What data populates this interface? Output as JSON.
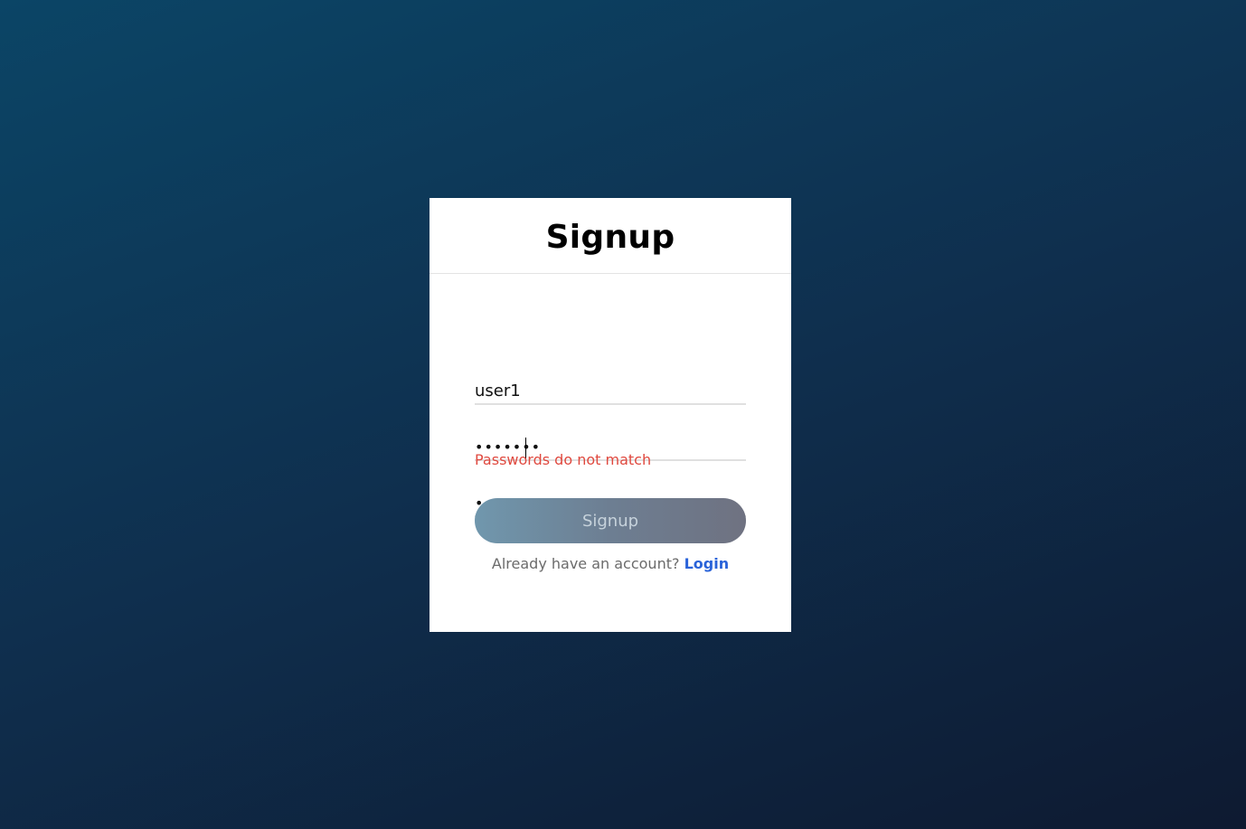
{
  "card": {
    "title": "Signup"
  },
  "form": {
    "username": {
      "value": "user1"
    },
    "password": {
      "value": "abcdefg"
    },
    "confirm_password": {
      "value": "abcdefh"
    },
    "error": "Passwords do not match",
    "submit_label": "Signup"
  },
  "footer": {
    "prompt": "Already have an account?",
    "link_label": "Login"
  },
  "colors": {
    "error": "#e0493f",
    "link": "#2a63d9",
    "background_start": "#0b4566",
    "background_end": "#0e1a31"
  }
}
